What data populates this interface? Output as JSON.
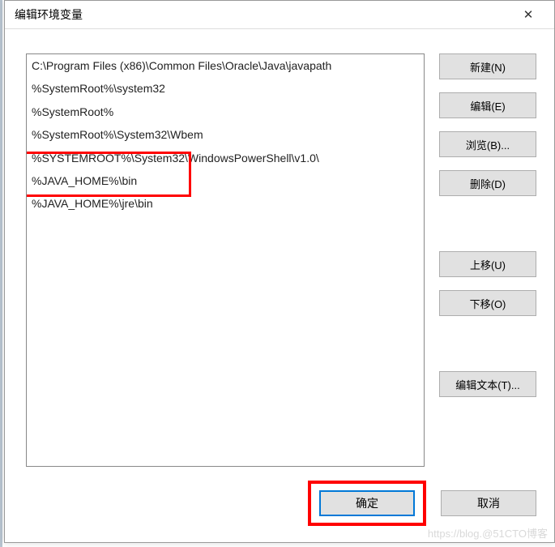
{
  "window": {
    "title": "编辑环境变量",
    "close_icon": "✕"
  },
  "paths": [
    "C:\\Program Files (x86)\\Common Files\\Oracle\\Java\\javapath",
    "%SystemRoot%\\system32",
    "%SystemRoot%",
    "%SystemRoot%\\System32\\Wbem",
    "%SYSTEMROOT%\\System32\\WindowsPowerShell\\v1.0\\",
    "%JAVA_HOME%\\bin",
    "%JAVA_HOME%\\jre\\bin"
  ],
  "buttons": {
    "new": "新建(N)",
    "edit": "编辑(E)",
    "browse": "浏览(B)...",
    "delete": "删除(D)",
    "move_up": "上移(U)",
    "move_down": "下移(O)",
    "edit_text": "编辑文本(T)..."
  },
  "footer": {
    "ok": "确定",
    "cancel": "取消"
  },
  "watermark": "https://blog.@51CTO博客"
}
